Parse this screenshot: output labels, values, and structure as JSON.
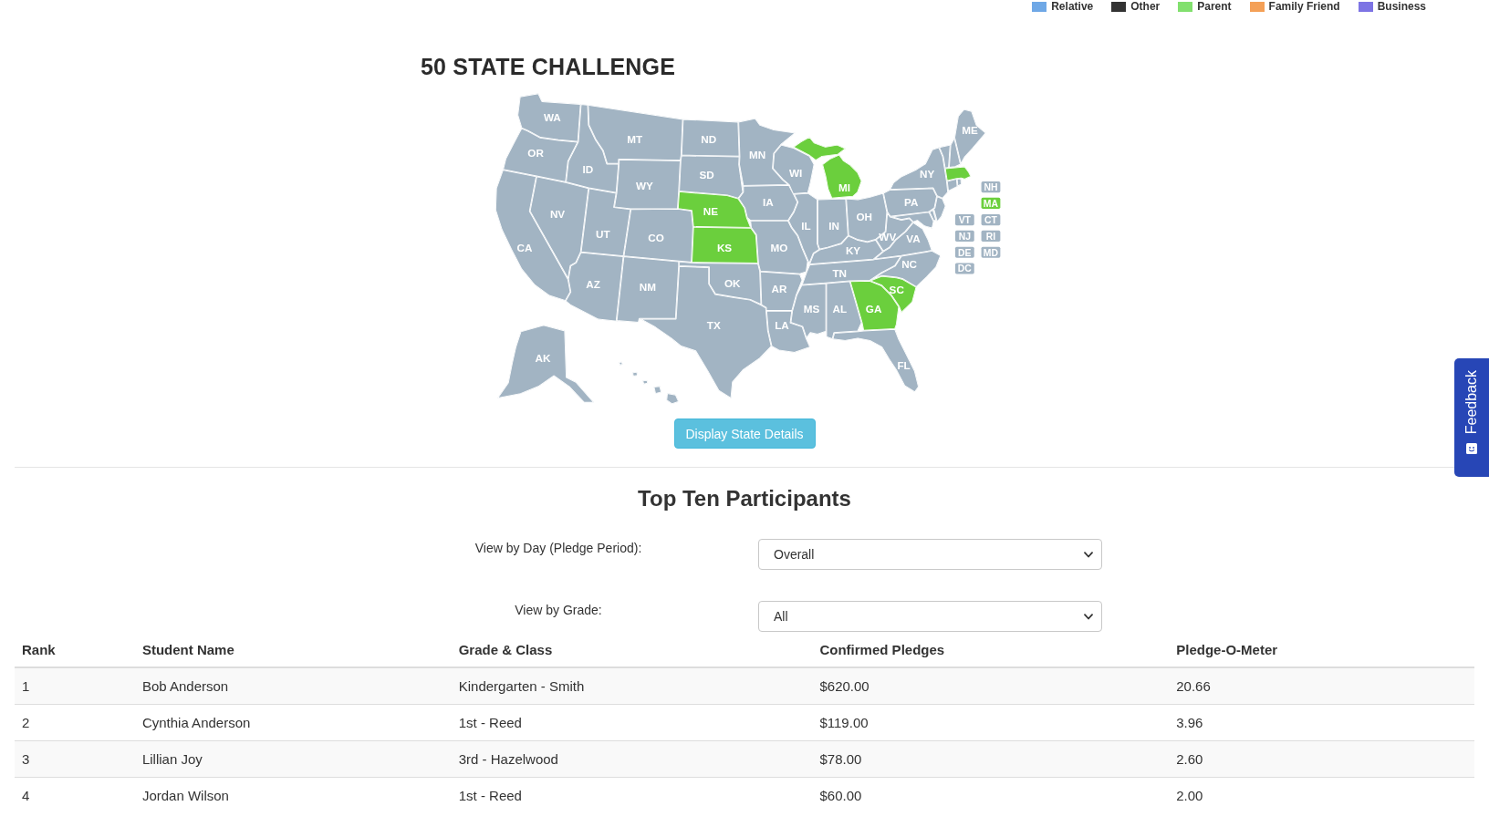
{
  "legend": [
    {
      "label": "Relative",
      "color": "#6fa8e6"
    },
    {
      "label": "Other",
      "color": "#333333"
    },
    {
      "label": "Parent",
      "color": "#82e06e"
    },
    {
      "label": "Family Friend",
      "color": "#f4a057"
    },
    {
      "label": "Business",
      "color": "#7d74e4"
    }
  ],
  "map": {
    "title": "50 STATE CHALLENGE",
    "states": [
      {
        "label": "WA",
        "completed": false
      },
      {
        "label": "ME",
        "completed": false
      },
      {
        "label": "MT",
        "completed": false
      },
      {
        "label": "ND",
        "completed": false
      },
      {
        "label": "OR",
        "completed": false
      },
      {
        "label": "MN",
        "completed": false
      },
      {
        "label": "ID",
        "completed": false
      },
      {
        "label": "SD",
        "completed": false
      },
      {
        "label": "WI",
        "completed": false
      },
      {
        "label": "NY",
        "completed": false
      },
      {
        "label": "WY",
        "completed": false
      },
      {
        "label": "MI",
        "completed": true
      },
      {
        "label": "IA",
        "completed": false
      },
      {
        "label": "PA",
        "completed": false
      },
      {
        "label": "NV",
        "completed": false
      },
      {
        "label": "NE",
        "completed": true
      },
      {
        "label": "OH",
        "completed": false
      },
      {
        "label": "IL",
        "completed": false
      },
      {
        "label": "IN",
        "completed": false
      },
      {
        "label": "UT",
        "completed": false
      },
      {
        "label": "CO",
        "completed": false
      },
      {
        "label": "WV",
        "completed": false
      },
      {
        "label": "VA",
        "completed": false
      },
      {
        "label": "CA",
        "completed": false
      },
      {
        "label": "KS",
        "completed": true
      },
      {
        "label": "MO",
        "completed": false
      },
      {
        "label": "KY",
        "completed": false
      },
      {
        "label": "NC",
        "completed": false
      },
      {
        "label": "TN",
        "completed": false
      },
      {
        "label": "AZ",
        "completed": false
      },
      {
        "label": "NM",
        "completed": false
      },
      {
        "label": "OK",
        "completed": false
      },
      {
        "label": "AR",
        "completed": false
      },
      {
        "label": "SC",
        "completed": true
      },
      {
        "label": "MS",
        "completed": false
      },
      {
        "label": "AL",
        "completed": false
      },
      {
        "label": "GA",
        "completed": true
      },
      {
        "label": "TX",
        "completed": false
      },
      {
        "label": "LA",
        "completed": false
      },
      {
        "label": "AK",
        "completed": false
      },
      {
        "label": "FL",
        "completed": false
      }
    ],
    "small_states": [
      {
        "completed": false
      },
      {
        "completed": false
      },
      {
        "completed": true
      },
      {
        "completed": false
      },
      {
        "completed": false
      },
      {
        "completed": false
      },
      {
        "completed": false
      },
      {
        "completed": false
      },
      {
        "completed": false
      }
    ],
    "badges": [
      {
        "label": "NH",
        "completed": false
      },
      {
        "label": "MA",
        "completed": true
      },
      {
        "label": "VT",
        "completed": false
      },
      {
        "label": "CT",
        "completed": false
      },
      {
        "label": "NJ",
        "completed": false
      },
      {
        "label": "RI",
        "completed": false
      },
      {
        "label": "DE",
        "completed": false
      },
      {
        "label": "MD",
        "completed": false
      },
      {
        "label": "DC",
        "completed": false
      }
    ],
    "button": "Display State Details"
  },
  "participants": {
    "title": "Top Ten Participants",
    "filters": [
      {
        "label": "View by Day (Pledge Period):",
        "value": "Overall"
      },
      {
        "label": "View by Grade:",
        "value": "All"
      }
    ],
    "table": {
      "columns": [
        "Rank",
        "Student Name",
        "Grade & Class",
        "Confirmed Pledges",
        "Pledge-O-Meter"
      ],
      "rows": [
        [
          "1",
          "Bob Anderson",
          "Kindergarten - Smith",
          "$620.00",
          "20.66"
        ],
        [
          "2",
          "Cynthia Anderson",
          "1st - Reed",
          "$119.00",
          "3.96"
        ],
        [
          "3",
          "Lillian Joy",
          "3rd - Hazelwood",
          "$78.00",
          "2.60"
        ],
        [
          "4",
          "Jordan Wilson",
          "1st - Reed",
          "$60.00",
          "2.00"
        ]
      ]
    }
  },
  "feedback_tab": {
    "label": "Feedback"
  }
}
